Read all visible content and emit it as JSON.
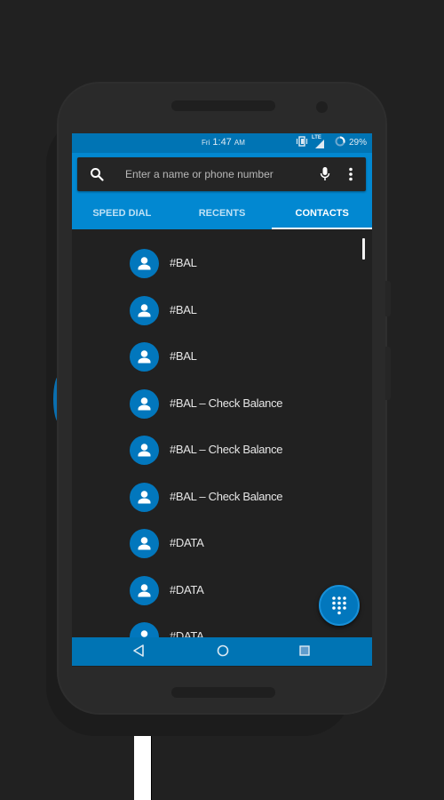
{
  "colors": {
    "primary": "#0288d1",
    "primary_dark": "#0074b4",
    "avatar": "#0277bd",
    "background": "#212121",
    "text": "#e6e6e6"
  },
  "status_bar": {
    "day": "Fri",
    "time": "1:47",
    "ampm": "AM",
    "network": "LTE",
    "battery": "29%",
    "icons": [
      "vibrate-icon",
      "lte-signal-icon",
      "battery-circle-icon"
    ]
  },
  "search": {
    "placeholder": "Enter a name or phone number",
    "value": "",
    "icons": [
      "search-icon",
      "mic-icon",
      "more-vert-icon"
    ]
  },
  "tabs": [
    {
      "label": "SPEED DIAL",
      "active": false
    },
    {
      "label": "RECENTS",
      "active": false
    },
    {
      "label": "CONTACTS",
      "active": true
    }
  ],
  "contacts": [
    {
      "name": "#BAL",
      "icon": "person-icon"
    },
    {
      "name": "#BAL",
      "icon": "person-icon"
    },
    {
      "name": "#BAL",
      "icon": "person-icon"
    },
    {
      "name": "#BAL – Check Balance",
      "icon": "person-icon"
    },
    {
      "name": "#BAL – Check Balance",
      "icon": "person-icon"
    },
    {
      "name": "#BAL – Check Balance",
      "icon": "person-icon"
    },
    {
      "name": "#DATA",
      "icon": "person-icon"
    },
    {
      "name": "#DATA",
      "icon": "person-icon"
    },
    {
      "name": "#DATA",
      "icon": "person-icon"
    }
  ],
  "fab": {
    "icon": "dialpad-icon"
  },
  "nav_bar": {
    "buttons": [
      "back-icon",
      "home-icon",
      "recents-icon"
    ]
  }
}
